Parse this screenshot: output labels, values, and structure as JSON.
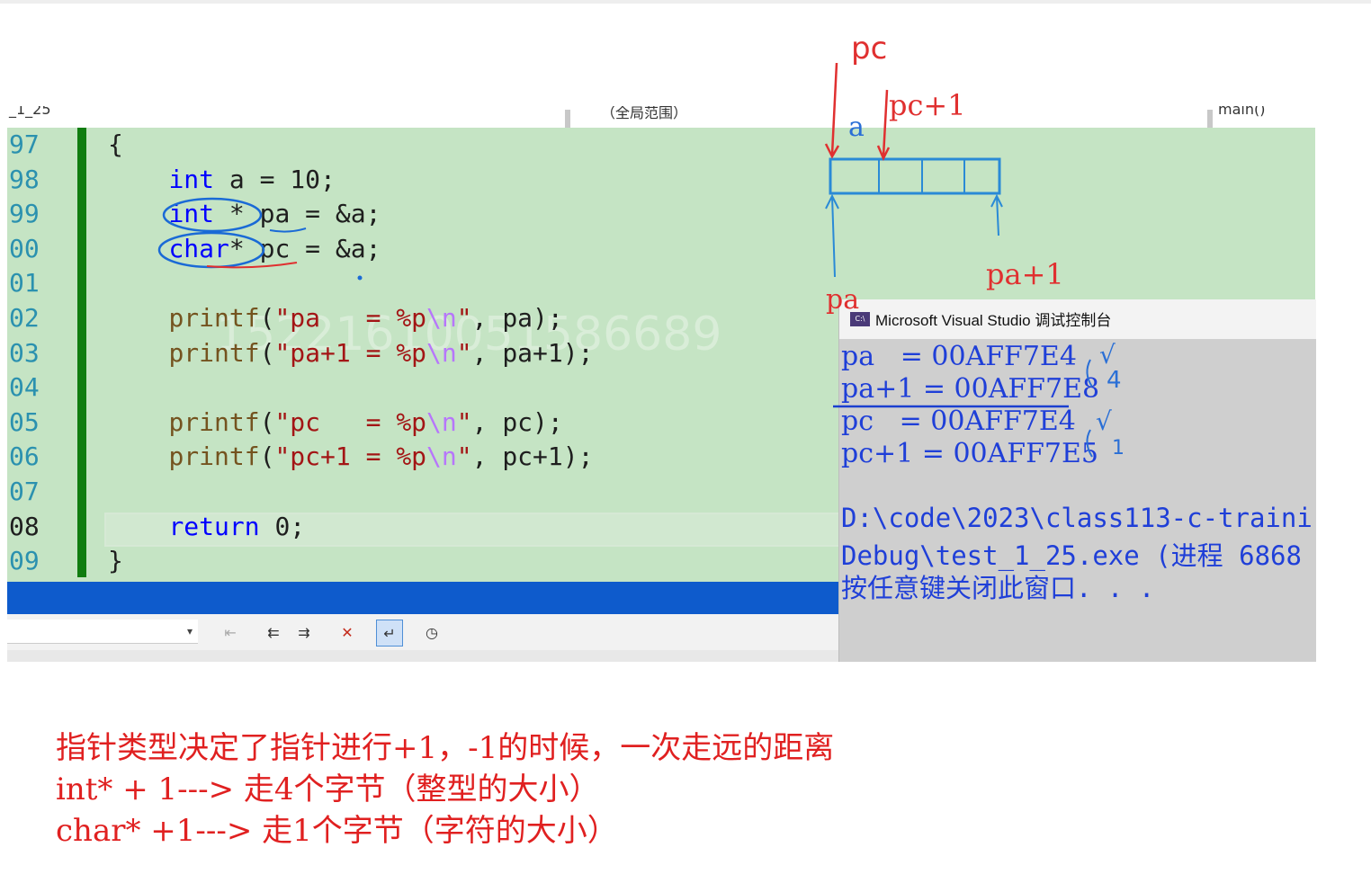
{
  "navbar": {
    "left": "_1_25",
    "middle": "（全局范围）",
    "right": "main()"
  },
  "editor": {
    "lines": [
      {
        "num": "97",
        "tokens": [
          [
            "p",
            "{"
          ]
        ]
      },
      {
        "num": "98",
        "tokens": [
          [
            "p",
            "    "
          ],
          [
            "k",
            "int"
          ],
          [
            "p",
            " a = 10;"
          ]
        ]
      },
      {
        "num": "99",
        "tokens": [
          [
            "p",
            "    "
          ],
          [
            "k",
            "int"
          ],
          [
            "p",
            " * pa = &a;"
          ]
        ]
      },
      {
        "num": "00",
        "tokens": [
          [
            "p",
            "    "
          ],
          [
            "k",
            "char"
          ],
          [
            "p",
            "* pc = &a;"
          ]
        ]
      },
      {
        "num": "01",
        "tokens": [
          [
            "p",
            ""
          ]
        ]
      },
      {
        "num": "02",
        "tokens": [
          [
            "p",
            "    "
          ],
          [
            "f",
            "printf"
          ],
          [
            "p",
            "("
          ],
          [
            "s",
            "\"pa   = %p"
          ],
          [
            "e",
            "\\n"
          ],
          [
            "s",
            "\""
          ],
          [
            "p",
            ", pa);"
          ]
        ]
      },
      {
        "num": "03",
        "tokens": [
          [
            "p",
            "    "
          ],
          [
            "f",
            "printf"
          ],
          [
            "p",
            "("
          ],
          [
            "s",
            "\"pa+1 = %p"
          ],
          [
            "e",
            "\\n"
          ],
          [
            "s",
            "\""
          ],
          [
            "p",
            ", pa+1);"
          ]
        ]
      },
      {
        "num": "04",
        "tokens": [
          [
            "p",
            ""
          ]
        ]
      },
      {
        "num": "05",
        "tokens": [
          [
            "p",
            "    "
          ],
          [
            "f",
            "printf"
          ],
          [
            "p",
            "("
          ],
          [
            "s",
            "\"pc   = %p"
          ],
          [
            "e",
            "\\n"
          ],
          [
            "s",
            "\""
          ],
          [
            "p",
            ", pc);"
          ]
        ]
      },
      {
        "num": "06",
        "tokens": [
          [
            "p",
            "    "
          ],
          [
            "f",
            "printf"
          ],
          [
            "p",
            "("
          ],
          [
            "s",
            "\"pc+1 = %p"
          ],
          [
            "e",
            "\\n"
          ],
          [
            "s",
            "\""
          ],
          [
            "p",
            ", pc+1);"
          ]
        ]
      },
      {
        "num": "07",
        "tokens": [
          [
            "p",
            ""
          ]
        ]
      },
      {
        "num": "08",
        "tokens": [
          [
            "p",
            "    "
          ],
          [
            "k",
            "return"
          ],
          [
            "p",
            " 0;"
          ]
        ],
        "current": true
      },
      {
        "num": "09",
        "tokens": [
          [
            "p",
            "}"
          ]
        ]
      }
    ],
    "watermark": "15221610051586689"
  },
  "console": {
    "title": "Microsoft Visual Studio 调试控制台",
    "icon_label": "C:\\",
    "output": [
      "pa   = 00AFF7E4",
      "pa+1 = 00AFF7E8",
      "pc   = 00AFF7E4",
      "pc+1 = 00AFF7E5"
    ],
    "path_line1": "D:\\code\\2023\\class113-c-traini",
    "path_line2": "Debug\\test_1_25.exe (进程 6868",
    "close_msg": "按任意键关闭此窗口. . ."
  },
  "annotations": {
    "pc_top": "pc",
    "pc_plus1": "pc+1",
    "a_label": "a",
    "pa_label": "pa",
    "pa_plus1": "pa+1",
    "check1": "√",
    "check2": "√",
    "mark4": "4",
    "mark1": "1"
  },
  "notes": [
    "指针类型决定了指针进行+1，-1的时候，一次走远的距离",
    "int* + 1---> 走4个字节（整型的大小）",
    "char* +1---> 走1个字节（字符的大小）"
  ],
  "colors": {
    "editor_bg": "#c5e4c4",
    "console_text": "#1f3fd8",
    "annotation_red": "#e03030",
    "annotation_blue": "#2a6fd6"
  }
}
